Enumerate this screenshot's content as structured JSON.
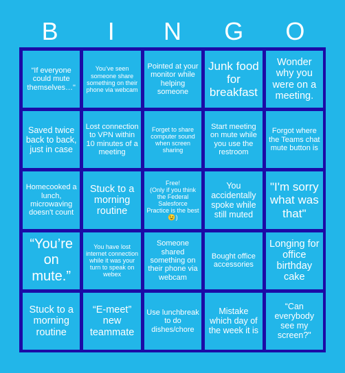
{
  "card": {
    "header": [
      "B",
      "I",
      "N",
      "G",
      "O"
    ],
    "colors": {
      "background": "#22b6e9",
      "grid_border": "#1b0ba6",
      "text": "#ffffff"
    },
    "cells": [
      {
        "text": "“If everyone could mute themselves…\"",
        "size": "s-sm"
      },
      {
        "text": "You’ve seen someone share something on their phone via webcam",
        "size": "s-xs"
      },
      {
        "text": "Pointed at your monitor while helping someone",
        "size": "s-sm"
      },
      {
        "text": "Junk food for breakfast",
        "size": "s-xl"
      },
      {
        "text": "Wonder why you were on a meeting.",
        "size": "s-lg"
      },
      {
        "text": "Saved twice back to back, just in case",
        "size": "s-md"
      },
      {
        "text": "Lost connection to VPN within 10 minutes of a meeting",
        "size": "s-sm"
      },
      {
        "text": "Forget to share computer sound when screen sharing",
        "size": "s-xs"
      },
      {
        "text": "Start meeting on mute while you use the restroom",
        "size": "s-sm"
      },
      {
        "text": "Forgot where the Teams chat mute button is",
        "size": "s-sm"
      },
      {
        "text": "Homecooked a lunch, microwaving doesn't count",
        "size": "s-sm"
      },
      {
        "text": "Stuck to a morning routine",
        "size": "s-lg"
      },
      {
        "text": "Free!\n(Only if you think the Federal Salesforce Practice is the best 😉)",
        "size": "s-xs",
        "free": true
      },
      {
        "text": "You accidentally spoke while still muted",
        "size": "s-md"
      },
      {
        "text": "\"I'm sorry what was that\"",
        "size": "s-xl"
      },
      {
        "text": "“You’re on mute.”",
        "size": "s-xxl"
      },
      {
        "text": "You have lost internet connection while it was your turn to speak on webex",
        "size": "s-xs"
      },
      {
        "text": "Someone shared something on their phone via webcam",
        "size": "s-sm"
      },
      {
        "text": "Bought office accessories",
        "size": "s-sm"
      },
      {
        "text": "Longing for office birthday cake",
        "size": "s-lg"
      },
      {
        "text": "Stuck to a morning routine",
        "size": "s-lg"
      },
      {
        "text": "“E-meet” new teammate",
        "size": "s-lg"
      },
      {
        "text": "Use lunchbreak to do dishes/chore",
        "size": "s-sm"
      },
      {
        "text": "Mistake which day of the week it is",
        "size": "s-md"
      },
      {
        "text": "“Can everybody see my screen?\"",
        "size": "s-md"
      }
    ]
  }
}
